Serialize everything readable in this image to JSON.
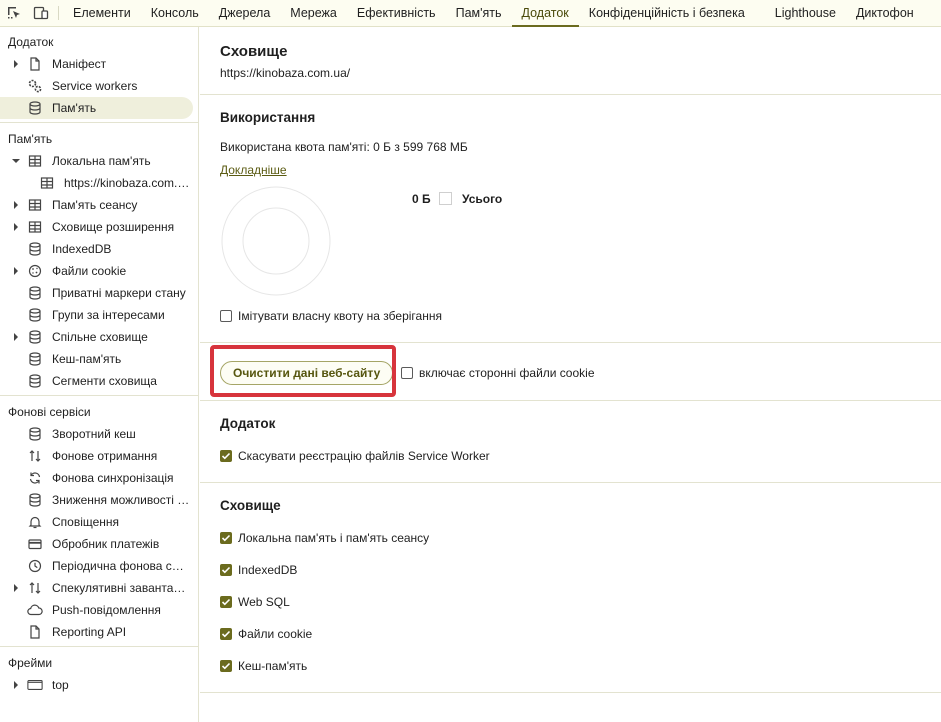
{
  "tabs": [
    {
      "label": "Елементи"
    },
    {
      "label": "Консоль"
    },
    {
      "label": "Джерела"
    },
    {
      "label": "Мережа"
    },
    {
      "label": "Ефективність"
    },
    {
      "label": "Пам'ять"
    },
    {
      "label": "Додаток",
      "active": true
    },
    {
      "label": "Конфіденційність і безпека"
    },
    {
      "label": "Lighthouse"
    },
    {
      "label": "Диктофон"
    }
  ],
  "sidebar": {
    "app": {
      "title": "Додаток",
      "items": [
        {
          "label": "Маніфест",
          "icon": "document-icon"
        },
        {
          "label": "Service workers",
          "icon": "gears-icon"
        },
        {
          "label": "Пам'ять",
          "icon": "database-icon"
        }
      ]
    },
    "storage": {
      "title": "Пам'ять",
      "items": [
        {
          "label": "Локальна пам'ять",
          "icon": "table-icon"
        },
        {
          "label": "https://kinobaza.com.ua",
          "icon": "table-icon"
        },
        {
          "label": "Пам'ять сеансу",
          "icon": "table-icon"
        },
        {
          "label": "Сховище розширення",
          "icon": "table-icon"
        },
        {
          "label": "IndexedDB",
          "icon": "database-icon"
        },
        {
          "label": "Файли cookie",
          "icon": "cookie-icon"
        },
        {
          "label": "Приватні маркери стану",
          "icon": "database-icon"
        },
        {
          "label": "Групи за інтересами",
          "icon": "database-icon"
        },
        {
          "label": "Спільне сховище",
          "icon": "database-icon"
        },
        {
          "label": "Кеш-пам'ять",
          "icon": "database-icon"
        },
        {
          "label": "Сегменти сховища",
          "icon": "database-icon"
        }
      ]
    },
    "background": {
      "title": "Фонові сервіси",
      "items": [
        {
          "label": "Зворотний кеш",
          "icon": "database-icon"
        },
        {
          "label": "Фонове отримання",
          "icon": "arrows-updown-icon"
        },
        {
          "label": "Фонова синхронізація",
          "icon": "sync-icon"
        },
        {
          "label": "Зниження можливості відстеження",
          "icon": "database-icon"
        },
        {
          "label": "Сповіщення",
          "icon": "bell-icon"
        },
        {
          "label": "Обробник платежів",
          "icon": "card-icon"
        },
        {
          "label": "Періодична фонова синхронізація",
          "icon": "clock-icon"
        },
        {
          "label": "Спекулятивні завантаження",
          "icon": "arrows-updown-icon"
        },
        {
          "label": "Push-повідомлення",
          "icon": "cloud-icon"
        },
        {
          "label": "Reporting API",
          "icon": "file-icon"
        }
      ]
    },
    "frames": {
      "title": "Фрейми",
      "items": [
        {
          "label": "top",
          "icon": "frame-icon"
        }
      ]
    }
  },
  "main": {
    "storage_title": "Сховище",
    "origin": "https://kinobaza.com.ua/",
    "usage_title": "Використання",
    "quota_text": "Використана квота пам'яті: 0 Б з 599 768 МБ",
    "learn_more": "Докладніше",
    "legend_value": "0 Б",
    "legend_label": "Усього",
    "simulate_quota": "Імітувати власну квоту на зберігання",
    "clear_button": "Очистити дані веб-сайту",
    "third_party_cookies": "включає сторонні файли cookie",
    "app_title": "Додаток",
    "unregister_sw": "Скасувати реєстрацію файлів Service Worker",
    "storage_list_title": "Сховище",
    "storage_checks": [
      "Локальна пам'ять і пам'ять сеансу",
      "IndexedDB",
      "Web SQL",
      "Файли cookie",
      "Кеш-пам'ять"
    ]
  },
  "colors": {
    "accent": "#6b6b1e",
    "highlight": "#d7343c",
    "toolbar_bg": "#fdfdf1"
  }
}
